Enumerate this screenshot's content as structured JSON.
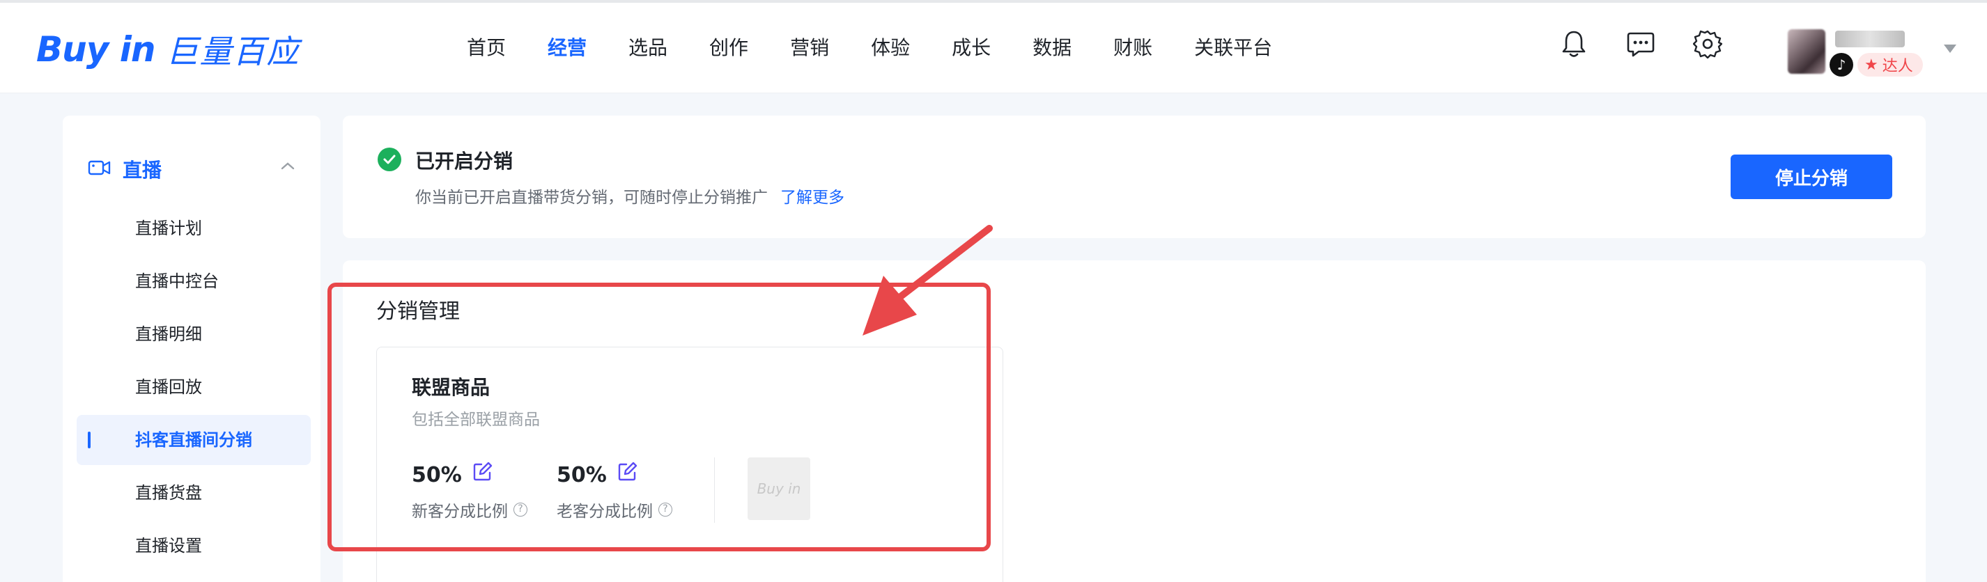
{
  "header": {
    "logo_en": "Buy in",
    "logo_cn": "巨量百应",
    "nav": [
      {
        "label": "首页",
        "active": false
      },
      {
        "label": "经营",
        "active": true
      },
      {
        "label": "选品",
        "active": false
      },
      {
        "label": "创作",
        "active": false
      },
      {
        "label": "营销",
        "active": false
      },
      {
        "label": "体验",
        "active": false
      },
      {
        "label": "成长",
        "active": false
      },
      {
        "label": "数据",
        "active": false
      },
      {
        "label": "财账",
        "active": false
      },
      {
        "label": "关联平台",
        "active": false
      }
    ],
    "icons": [
      "bell-icon",
      "message-icon",
      "gear-icon"
    ],
    "user": {
      "role_badge": "达人"
    }
  },
  "sidebar": {
    "group_label": "直播",
    "items": [
      {
        "label": "直播计划",
        "active": false
      },
      {
        "label": "直播中控台",
        "active": false
      },
      {
        "label": "直播明细",
        "active": false
      },
      {
        "label": "直播回放",
        "active": false
      },
      {
        "label": "抖客直播间分销",
        "active": true
      },
      {
        "label": "直播货盘",
        "active": false
      },
      {
        "label": "直播设置",
        "active": false
      }
    ]
  },
  "status_card": {
    "title": "已开启分销",
    "description": "你当前已开启直播带货分销，可随时停止分销推广",
    "learn_more": "了解更多",
    "stop_button": "停止分销"
  },
  "distribution": {
    "section_title": "分销管理",
    "product_card": {
      "title": "联盟商品",
      "subtitle": "包括全部联盟商品",
      "new_ratio": {
        "value": "50%",
        "label": "新客分成比例"
      },
      "old_ratio": {
        "value": "50%",
        "label": "老客分成比例"
      },
      "thumbnail_text": "Buy in"
    }
  },
  "colors": {
    "brand": "#1966ff",
    "success": "#1cb05c",
    "annotation": "#e8474a"
  }
}
